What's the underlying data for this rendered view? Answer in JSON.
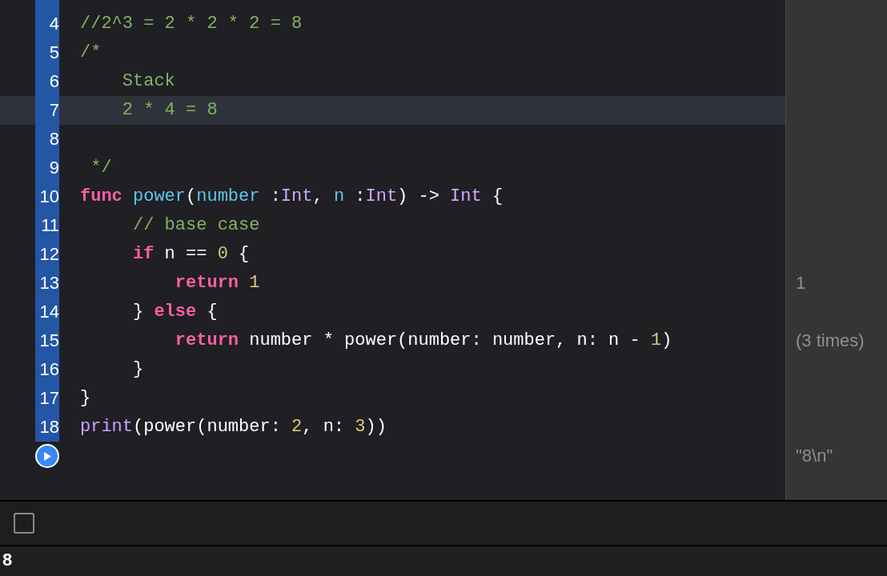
{
  "editor": {
    "lines": [
      {
        "number": "4",
        "selected": false,
        "tokens": [
          {
            "kind": "comment",
            "text": "//2^3 = 2 * 2 * 2 = 8"
          }
        ]
      },
      {
        "number": "5",
        "selected": false,
        "tokens": [
          {
            "kind": "comment",
            "text": "/*"
          }
        ]
      },
      {
        "number": "6",
        "selected": false,
        "tokens": [
          {
            "kind": "comment",
            "text": "    Stack"
          }
        ]
      },
      {
        "number": "7",
        "selected": true,
        "tokens": [
          {
            "kind": "comment",
            "text": "    2 * 4 = 8"
          }
        ]
      },
      {
        "number": "8",
        "selected": false
      },
      {
        "number": "9",
        "selected": false,
        "tokens": [
          {
            "kind": "comment",
            "text": " */"
          }
        ]
      },
      {
        "number": "10",
        "selected": false,
        "tokens": [
          {
            "kind": "keyword",
            "text": "func "
          },
          {
            "kind": "declaration",
            "text": "power"
          },
          {
            "kind": "plain",
            "text": "("
          },
          {
            "kind": "declaration",
            "text": "number"
          },
          {
            "kind": "plain",
            "text": " :"
          },
          {
            "kind": "type",
            "text": "Int"
          },
          {
            "kind": "plain",
            "text": ", "
          },
          {
            "kind": "declaration",
            "text": "n"
          },
          {
            "kind": "plain",
            "text": " :"
          },
          {
            "kind": "type",
            "text": "Int"
          },
          {
            "kind": "plain",
            "text": ") -> "
          },
          {
            "kind": "type",
            "text": "Int"
          },
          {
            "kind": "plain",
            "text": " {"
          }
        ]
      },
      {
        "number": "11",
        "selected": false,
        "tokens": [
          {
            "kind": "comment",
            "text": "     // base case"
          }
        ]
      },
      {
        "number": "12",
        "selected": false,
        "tokens": [
          {
            "kind": "keyword",
            "text": "     if"
          },
          {
            "kind": "plain",
            "text": " n == "
          },
          {
            "kind": "number",
            "text": "0"
          },
          {
            "kind": "plain",
            "text": " {"
          }
        ]
      },
      {
        "number": "13",
        "selected": false,
        "tokens": [
          {
            "kind": "keyword",
            "text": "         return"
          },
          {
            "kind": "number",
            "text": " 1"
          }
        ],
        "result": "1"
      },
      {
        "number": "14",
        "selected": false,
        "tokens": [
          {
            "kind": "plain",
            "text": "     } "
          },
          {
            "kind": "keyword",
            "text": "else"
          },
          {
            "kind": "plain",
            "text": " {"
          }
        ]
      },
      {
        "number": "15",
        "selected": false,
        "tokens": [
          {
            "kind": "keyword",
            "text": "         return"
          },
          {
            "kind": "plain",
            "text": " number * power(number: number, n: n - "
          },
          {
            "kind": "number",
            "text": "1"
          },
          {
            "kind": "plain",
            "text": ")"
          }
        ],
        "result": "(3 times)"
      },
      {
        "number": "16",
        "selected": false,
        "tokens": [
          {
            "kind": "plain",
            "text": "     }"
          }
        ]
      },
      {
        "number": "17",
        "selected": false,
        "tokens": [
          {
            "kind": "plain",
            "text": "}"
          }
        ]
      },
      {
        "number": "18",
        "selected": false,
        "tokens": [
          {
            "kind": "builtin",
            "text": "print"
          },
          {
            "kind": "plain",
            "text": "(power(number: "
          },
          {
            "kind": "number",
            "text": "2"
          },
          {
            "kind": "plain",
            "text": ", n: "
          },
          {
            "kind": "number",
            "text": "3"
          },
          {
            "kind": "plain",
            "text": "))"
          }
        ]
      }
    ],
    "run_row": {
      "result": "\"8\\n\""
    }
  },
  "debug_bar": {
    "checkbox": {
      "checked": false
    }
  },
  "console": {
    "output": "8"
  }
}
